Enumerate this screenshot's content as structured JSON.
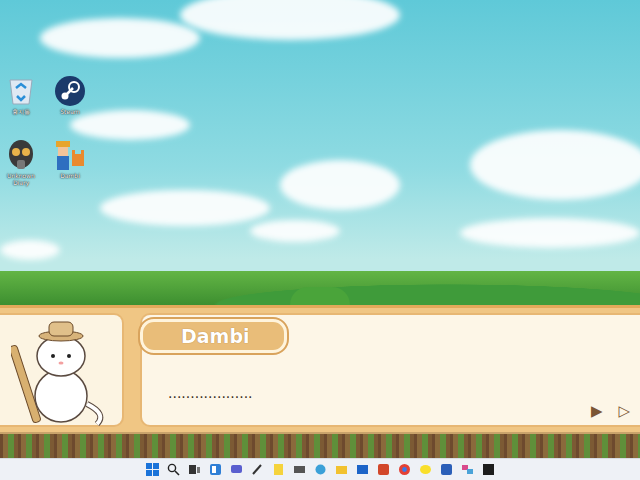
{
  "desktop": {
    "icons": [
      {
        "label": "휴지통"
      },
      {
        "label": "Steam"
      },
      {
        "label": "Unknown Diary"
      },
      {
        "label": "Dambi"
      }
    ]
  },
  "dialog": {
    "speaker": "Dambi",
    "text": "...................",
    "buttons": [
      "▶",
      "▷"
    ]
  }
}
